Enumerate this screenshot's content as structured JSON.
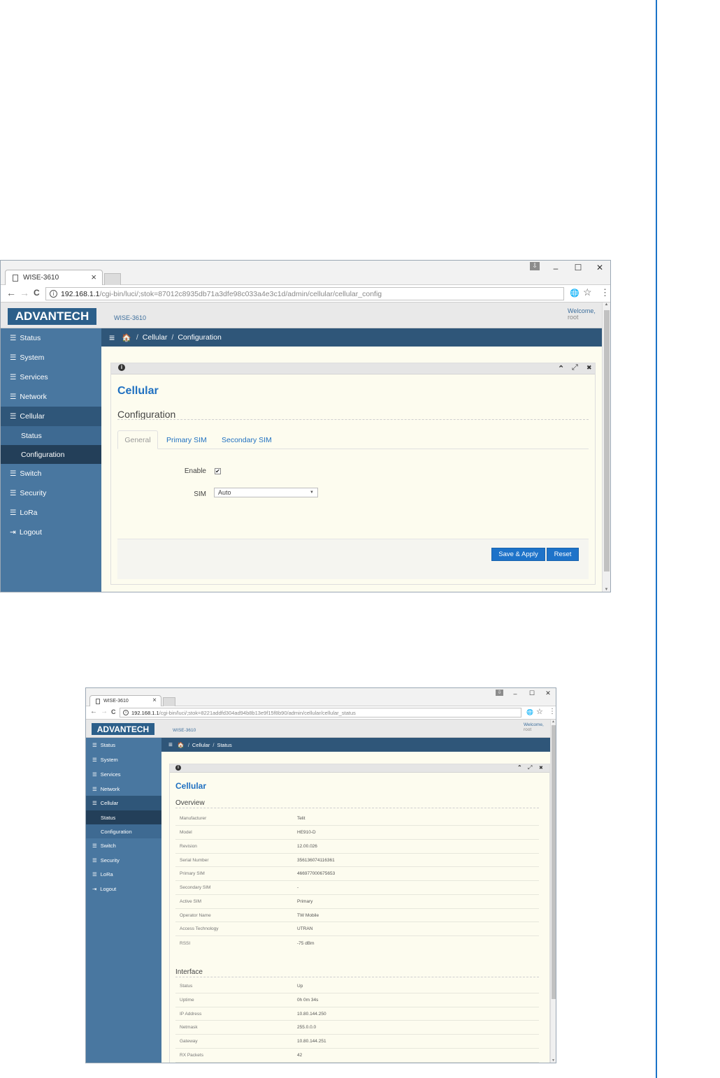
{
  "window1": {
    "tab_title": "WISE-3610",
    "tab_close": "×",
    "window_controls": {
      "profile": "⇩",
      "minimize": "–",
      "maximize": "☐",
      "close": "✕"
    },
    "nav": {
      "back": "←",
      "forward": "→",
      "reload": "C"
    },
    "address_info": "i",
    "address_host": "192.168.1.1",
    "address_path": "/cgi-bin/luci/;stok=87012c8935db71a3dfe98c033a4e3c1d/admin/cellular/cellular_config",
    "tools": {
      "translate": "🌐",
      "star": "☆",
      "menu": "⋮"
    },
    "app": {
      "logo": "ADVANTECH",
      "device": "WISE-3610",
      "welcome": "Welcome,",
      "user": "root",
      "breadcrumb": {
        "menu": "≡",
        "home": "🏠",
        "sep": "/",
        "section": "Cellular",
        "page": "Configuration"
      },
      "sidebar": {
        "icon": "☰",
        "logout_icon": "⇥",
        "items": [
          {
            "label": "Status"
          },
          {
            "label": "System"
          },
          {
            "label": "Services"
          },
          {
            "label": "Network"
          },
          {
            "label": "Cellular"
          },
          {
            "label": "Status"
          },
          {
            "label": "Configuration"
          },
          {
            "label": "Switch"
          },
          {
            "label": "Security"
          },
          {
            "label": "LoRa"
          },
          {
            "label": "Logout"
          }
        ]
      },
      "panel": {
        "info_icon": "i",
        "controls": {
          "collapse": "⌃",
          "expand": "⤢",
          "close": "✖"
        },
        "title": "Cellular",
        "section": "Configuration",
        "tabs": [
          {
            "label": "General"
          },
          {
            "label": "Primary SIM"
          },
          {
            "label": "Secondary SIM"
          }
        ],
        "fields": {
          "enable_label": "Enable",
          "enable_mark": "✔",
          "sim_label": "SIM",
          "sim_value": "Auto",
          "sim_arrow": "▼"
        },
        "buttons": {
          "save": "Save & Apply",
          "reset": "Reset"
        }
      }
    }
  },
  "window2": {
    "tab_title": "WISE-3610",
    "tab_close": "×",
    "window_controls": {
      "profile": "⇩",
      "minimize": "–",
      "maximize": "☐",
      "close": "✕"
    },
    "nav": {
      "back": "←",
      "forward": "→",
      "reload": "C"
    },
    "address_info": "i",
    "address_host": "192.168.1.1",
    "address_path": "/cgi-bin/luci/;stok=8221addfd304ad94b8b13e9f15f8b90/admin/cellular/cellular_status",
    "tools": {
      "translate": "🌐",
      "star": "☆",
      "menu": "⋮"
    },
    "app": {
      "logo": "ADVANTECH",
      "device": "WISE-3610",
      "welcome": "Welcome,",
      "user": "root",
      "breadcrumb": {
        "menu": "≡",
        "home": "🏠",
        "sep": "/",
        "section": "Cellular",
        "page": "Status"
      },
      "sidebar": {
        "icon": "☰",
        "logout_icon": "⇥",
        "items": [
          {
            "label": "Status"
          },
          {
            "label": "System"
          },
          {
            "label": "Services"
          },
          {
            "label": "Network"
          },
          {
            "label": "Cellular"
          },
          {
            "label": "Status"
          },
          {
            "label": "Configuration"
          },
          {
            "label": "Switch"
          },
          {
            "label": "Security"
          },
          {
            "label": "LoRa"
          },
          {
            "label": "Logout"
          }
        ]
      },
      "panel": {
        "info_icon": "i",
        "controls": {
          "collapse": "⌃",
          "expand": "⤢",
          "close": "✖"
        },
        "title": "Cellular",
        "overview_title": "Overview",
        "overview": [
          {
            "key": "Manufacturer",
            "value": "Telit"
          },
          {
            "key": "Model",
            "value": "HE910-D"
          },
          {
            "key": "Revision",
            "value": "12.00.026"
          },
          {
            "key": "Serial Number",
            "value": "356136074116361"
          },
          {
            "key": "Primary SIM",
            "value": "466977000675653"
          },
          {
            "key": "Secondary SIM",
            "value": "-"
          },
          {
            "key": "Active SIM",
            "value": "Primary"
          },
          {
            "key": "Operator Name",
            "value": "TW Mobile"
          },
          {
            "key": "Access Technology",
            "value": "UTRAN"
          },
          {
            "key": "RSSI",
            "value": "-75 dBm"
          }
        ],
        "interface_title": "Interface",
        "interface": [
          {
            "key": "Status",
            "value": "Up"
          },
          {
            "key": "Uptime",
            "value": "0h 0m 34s"
          },
          {
            "key": "IP Address",
            "value": "10.80.144.250"
          },
          {
            "key": "Netmask",
            "value": "255.0.0.0"
          },
          {
            "key": "Gateway",
            "value": "10.80.144.251"
          },
          {
            "key": "RX Packets",
            "value": "42"
          }
        ]
      }
    }
  }
}
